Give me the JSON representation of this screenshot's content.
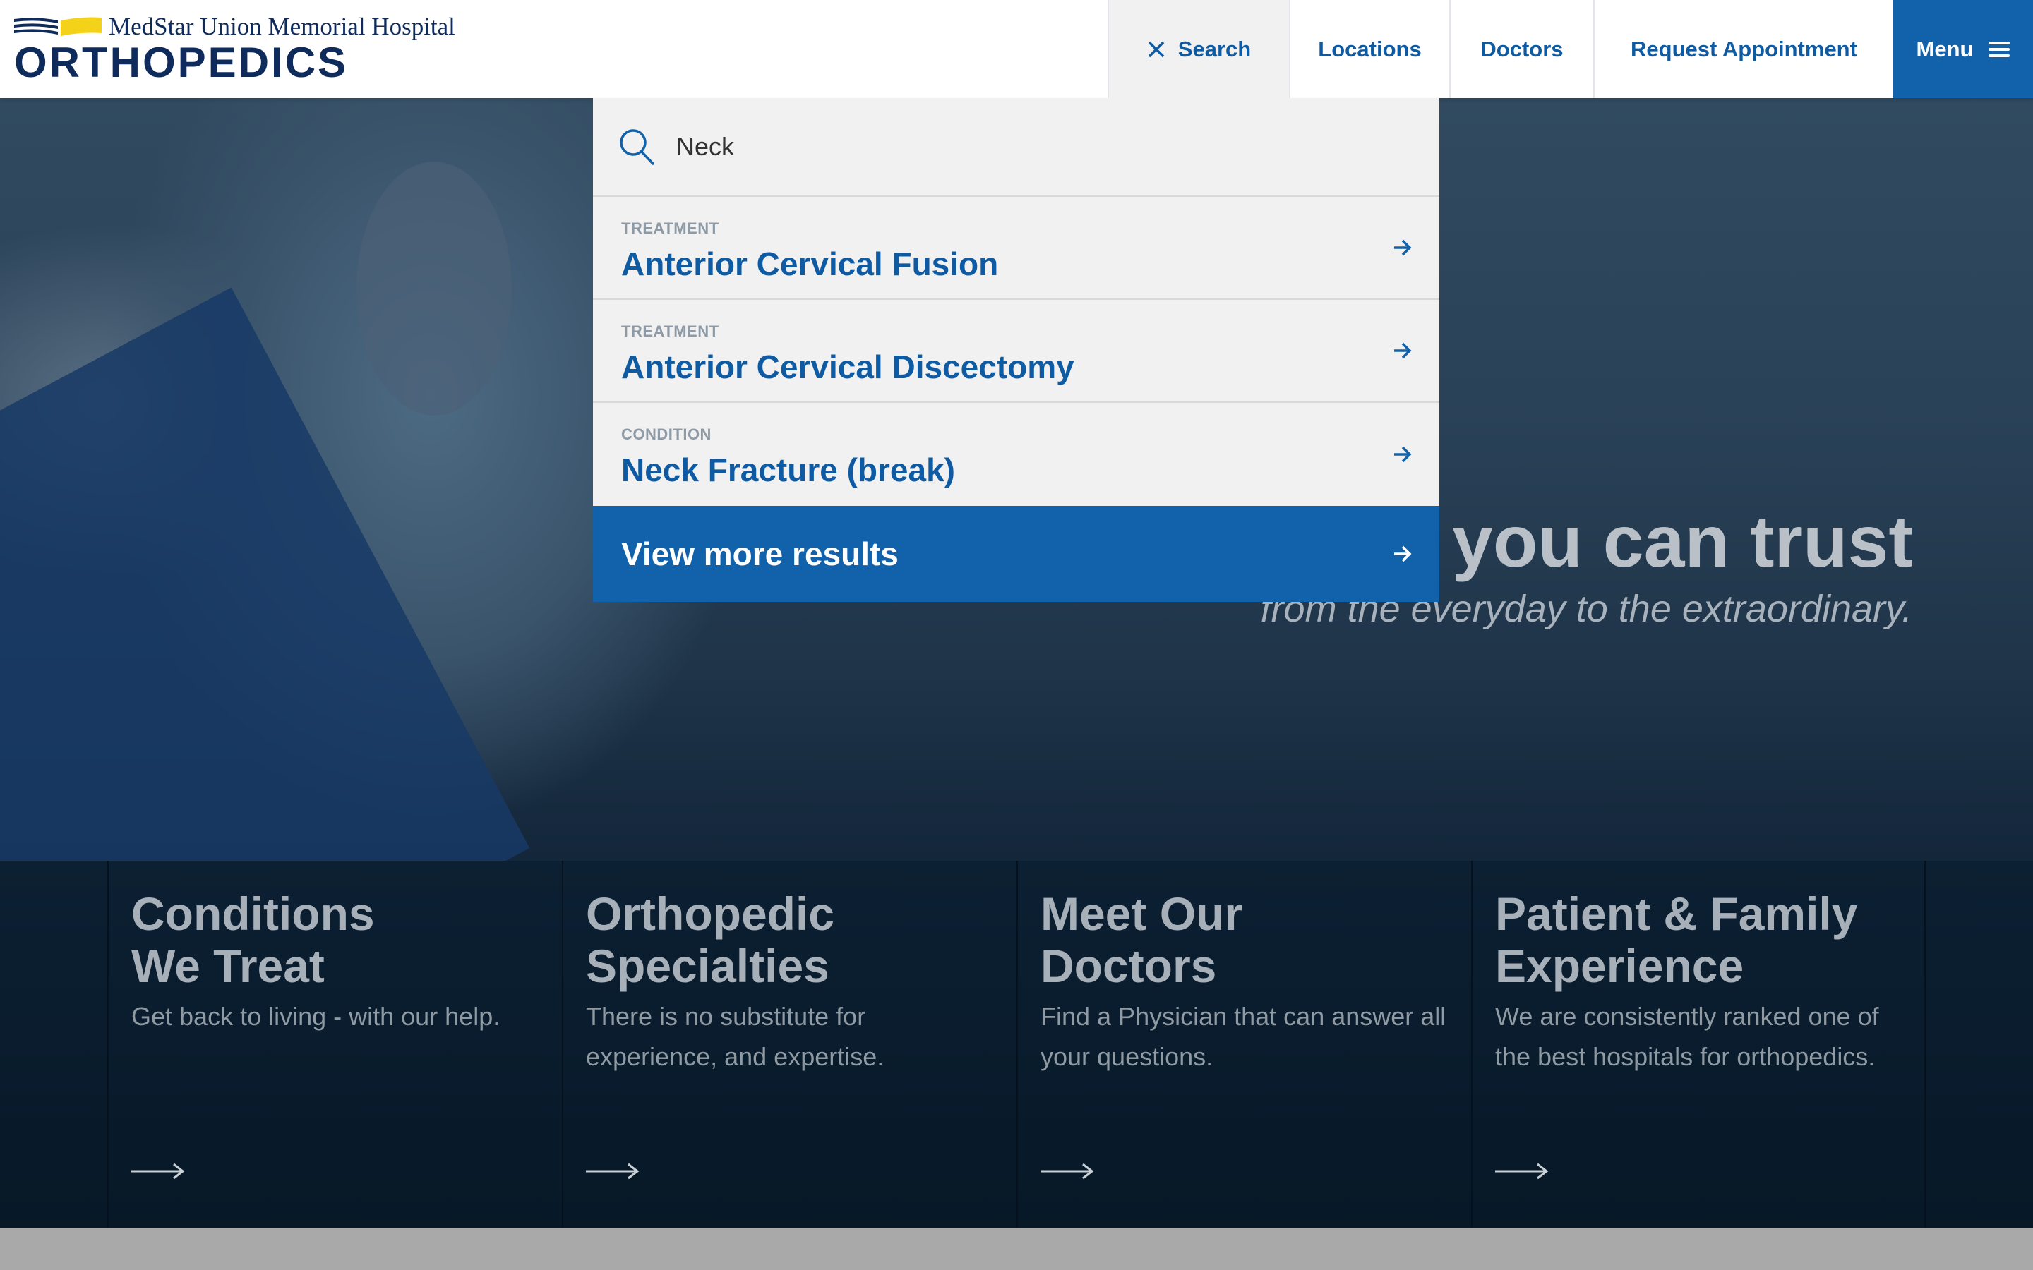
{
  "brand": {
    "hospital": "MedStar Union Memorial Hospital",
    "department": "ORTHOPEDICS",
    "colors": {
      "navy": "#0f2b5c",
      "blue": "#1262ab",
      "yellow": "#f5d21a"
    }
  },
  "nav": {
    "search": {
      "label": "Search",
      "icon": "close-icon"
    },
    "locations": "Locations",
    "doctors": "Doctors",
    "request": "Request Appointment",
    "menu": {
      "label": "Menu",
      "icon": "hamburger-icon"
    }
  },
  "search": {
    "query": "Neck",
    "results": [
      {
        "type": "TREATMENT",
        "title": "Anterior Cervical Fusion"
      },
      {
        "type": "TREATMENT",
        "title": "Anterior Cervical Discectomy"
      },
      {
        "type": "CONDITION",
        "title": "Neck Fracture (break)"
      }
    ],
    "view_more": "View more results"
  },
  "hero": {
    "headline_visible": "you can trust",
    "subtitle_visible": "from the everyday to the extraordinary."
  },
  "cards": [
    {
      "title": "Conditions\nWe Treat",
      "desc": "Get back to living - with our help."
    },
    {
      "title": "Orthopedic\nSpecialties",
      "desc": "There is no substitute for experience, and expertise."
    },
    {
      "title": "Meet Our\nDoctors",
      "desc": "Find a Physician that can answer all your questions."
    },
    {
      "title": "Patient & Family\nExperience",
      "desc": "We are consistently ranked one of the best hospitals for orthopedics."
    }
  ]
}
